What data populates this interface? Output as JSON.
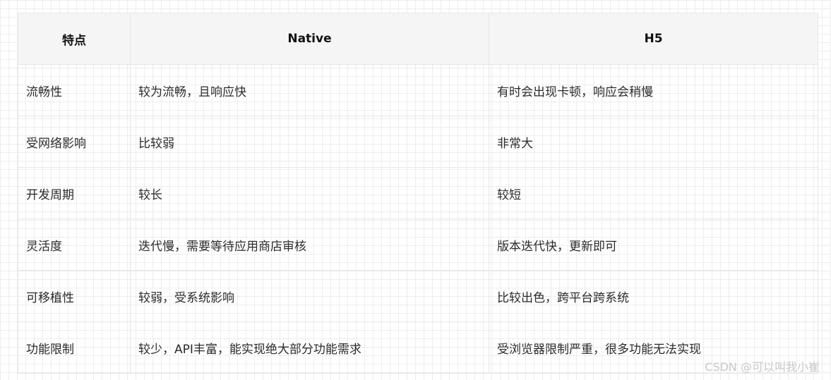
{
  "table": {
    "headers": [
      "特点",
      "Native",
      "H5"
    ],
    "rows": [
      [
        "流畅性",
        "较为流畅，且响应快",
        "有时会出现卡顿，响应会稍慢"
      ],
      [
        "受网络影响",
        "比较弱",
        "非常大"
      ],
      [
        "开发周期",
        "较长",
        "较短"
      ],
      [
        "灵活度",
        "迭代慢，需要等待应用商店审核",
        "版本迭代快，更新即可"
      ],
      [
        "可移植性",
        "较弱，受系统影响",
        "比较出色，跨平台跨系统"
      ],
      [
        "功能限制",
        "较少，API丰富，能实现绝大部分功能需求",
        "受浏览器限制严重，很多功能无法实现"
      ]
    ]
  },
  "watermark": "CSDN @可以叫我小崔"
}
